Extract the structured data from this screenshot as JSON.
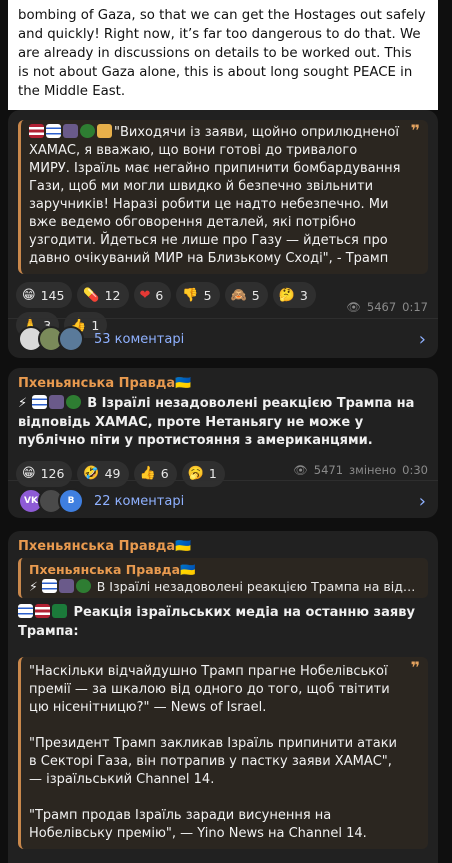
{
  "post1": {
    "english_text": "bombing of Gaza, so that we can get the Hostages out safely and quickly! Right now, it’s far too dangerous to do that. We are already in discussions on details to be worked out. This is not about Gaza alone, this is about long sought PEACE in the Middle East.",
    "quote_text": "\"Виходячи із заяви, щойно оприлюдненої ХАМАС, я вважаю, що вони готові до тривалого МИРУ. Ізраїль має негайно припинити бомбардування Гази, щоб ми могли швидко й безпечно звільнити заручників! Наразі робити це надто небезпечно. Ми вже ведемо обговорення деталей, які потрібно узгодити. Йдеться не лише про Газу — йдеться про давно очікуваний МИР на Близькому Сході\", - Трамп",
    "reactions": [
      {
        "icon": "grin-emoji",
        "glyph": "😁",
        "count": "145"
      },
      {
        "icon": "pill-emoji",
        "glyph": "💊",
        "count": "12"
      },
      {
        "icon": "heart-emoji",
        "glyph": "❤",
        "count": "6"
      },
      {
        "icon": "thumbs-down-emoji",
        "glyph": "👎",
        "count": "5"
      },
      {
        "icon": "monkey-emoji",
        "glyph": "🙈",
        "count": "5"
      },
      {
        "icon": "thinking-emoji",
        "glyph": "🤔",
        "count": "3"
      },
      {
        "icon": "pray-emoji",
        "glyph": "🙏",
        "count": "3"
      },
      {
        "icon": "thumbs-up-emoji",
        "glyph": "👍",
        "count": "1"
      }
    ],
    "views": "5467",
    "time": "0:17",
    "comments_label": "53 коментарі"
  },
  "post2": {
    "sender": "Пхеньянська Правда🇺🇦",
    "text": "В Ізраїлі незадоволені реакцією Трампа на відповідь ХАМАС, проте Нетаньягу не може у публічно піти у протистояння з американцями.",
    "reactions": [
      {
        "icon": "grin-emoji",
        "glyph": "😁",
        "count": "126"
      },
      {
        "icon": "rofl-emoji",
        "glyph": "🤣",
        "count": "49"
      },
      {
        "icon": "thumbs-up-emoji",
        "glyph": "👍",
        "count": "6"
      },
      {
        "icon": "yawn-emoji",
        "glyph": "🥱",
        "count": "1"
      }
    ],
    "views": "5471",
    "edited": "змінено",
    "time": "0:30",
    "avatar_initials": [
      "VK",
      "",
      "B"
    ],
    "comments_label": "22 коментарі"
  },
  "post3": {
    "sender": "Пхеньянська Правда🇺🇦",
    "reply_name": "Пхеньянська Правда🇺🇦",
    "reply_text": "В Ізраїлі незадоволені реакцією Трампа на відпо...",
    "headline": "Реакція ізраїльських медіа на останню заяву Трампа:",
    "quote_p1": "\"Наскільки відчайдушно Трамп прагне Нобелівської премії — за шкалою від одного до того, щоб твітити цю нісенітницю?\" — News of Israel.",
    "quote_p2": "\"Президент Трамп закликав Ізраїль припинити атаки в Секторі Газа, він потрапив у пастку заяви ХАМАС\", — ізраїльський Channel 14.",
    "quote_p3": "\"Трамп продав Ізраїль заради висунення на Нобелівську премію\", — Yino News на Channel 14."
  },
  "colors": {
    "background": "#0f0f0f",
    "bubble": "#212121",
    "accent": "#e89a4f",
    "link": "#8fb1ff",
    "quote_bg": "#2b2620"
  }
}
